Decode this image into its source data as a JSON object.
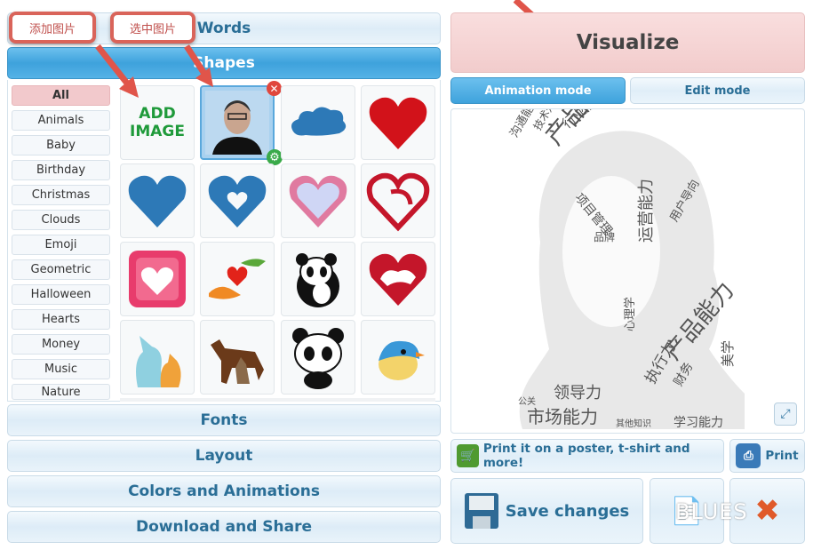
{
  "panels": {
    "words": "Words",
    "shapes": "Shapes",
    "fonts": "Fonts",
    "layout": "Layout",
    "colors": "Colors and Animations",
    "download": "Download and Share"
  },
  "annotations": {
    "add_image": "添加图片",
    "select_image": "选中图片"
  },
  "categories": [
    "All",
    "Animals",
    "Baby",
    "Birthday",
    "Christmas",
    "Clouds",
    "Emoji",
    "Geometric",
    "Halloween",
    "Hearts",
    "Money",
    "Music",
    "Nature"
  ],
  "selected_category": "All",
  "shapes": {
    "add_image": "ADD\nIMAGE",
    "add_image_line1": "ADD",
    "add_image_line2": "IMAGE",
    "items": [
      "photo-portrait",
      "cloud",
      "heart-red",
      "heart-blue",
      "heart-blue-cutout",
      "heart-pink-outline",
      "heart-arrow",
      "heart-square-pink",
      "hands-heart",
      "panda-wwf",
      "heart-cat-dog",
      "cat-dog-pastel",
      "dog-cat-brown",
      "panda-cartoon",
      "bird-blue"
    ]
  },
  "visualize": "Visualize",
  "tabs": {
    "animation": "Animation mode",
    "edit": "Edit mode",
    "active": "animation"
  },
  "wordcloud": {
    "words": [
      "产品经理",
      "行业融入感",
      "项目管理",
      "运营能力",
      "沟通能力",
      "技术知识",
      "品牌",
      "心理学",
      "产品能力",
      "执行力",
      "财务",
      "美学",
      "领导力",
      "市场能力",
      "学习能力",
      "公关",
      "其他知识",
      "用户导向"
    ]
  },
  "actions": {
    "print_poster": "Print it on a poster, t-shirt and more!",
    "print": "Print",
    "save": "Save changes"
  },
  "watermark": "BLUES",
  "colors": {
    "accent": "#3ea2dc",
    "text": "#2a6e96",
    "selected": "#f2c9cc",
    "annotation": "#d9645a"
  }
}
